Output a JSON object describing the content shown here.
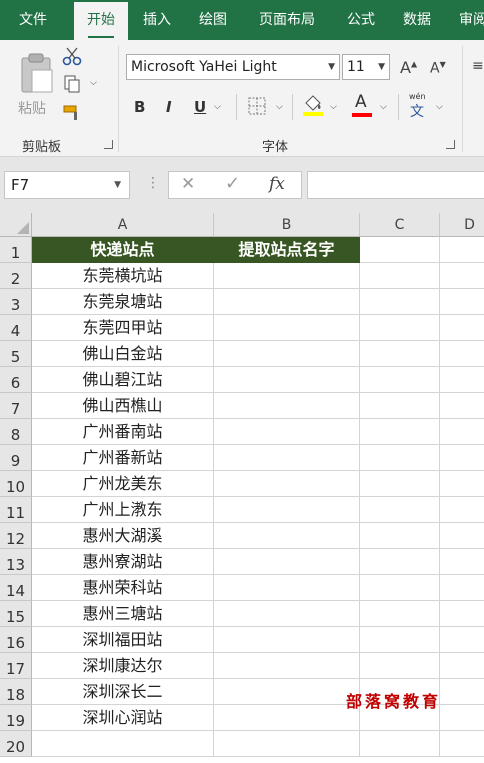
{
  "tabs": [
    {
      "label": "文件",
      "active": false
    },
    {
      "label": "开始",
      "active": true
    },
    {
      "label": "插入",
      "active": false
    },
    {
      "label": "绘图",
      "active": false
    },
    {
      "label": "页面布局",
      "active": false
    },
    {
      "label": "公式",
      "active": false
    },
    {
      "label": "数据",
      "active": false
    },
    {
      "label": "审阅",
      "active": false
    }
  ],
  "ribbon": {
    "clipboard": {
      "paste_label": "粘贴",
      "group_label": "剪贴板"
    },
    "font": {
      "font_name": "Microsoft YaHei Light",
      "font_size": "11",
      "bold_label": "B",
      "italic_label": "I",
      "underline_label": "U",
      "grow_label": "A",
      "shrink_label": "A",
      "font_color_label": "A",
      "phonetic_label": "wén",
      "phonetic_char": "文",
      "group_label": "字体",
      "highlight_color": "#ffff00",
      "font_color": "#ff0000"
    }
  },
  "formula_bar": {
    "name_box": "F7",
    "cancel_symbol": "✕",
    "enter_symbol": "✓",
    "fx_label": "fx",
    "formula": ""
  },
  "sheet": {
    "columns": [
      "A",
      "B",
      "C",
      "D"
    ],
    "rows": [
      {
        "num": "1",
        "a": "快递站点",
        "b": "提取站点名字"
      },
      {
        "num": "2",
        "a": "东莞横坑站",
        "b": ""
      },
      {
        "num": "3",
        "a": "东莞泉塘站",
        "b": ""
      },
      {
        "num": "4",
        "a": "东莞四甲站",
        "b": ""
      },
      {
        "num": "5",
        "a": "佛山白金站",
        "b": ""
      },
      {
        "num": "6",
        "a": "佛山碧江站",
        "b": ""
      },
      {
        "num": "7",
        "a": "佛山西樵山",
        "b": ""
      },
      {
        "num": "8",
        "a": "广州番南站",
        "b": ""
      },
      {
        "num": "9",
        "a": "广州番新站",
        "b": ""
      },
      {
        "num": "10",
        "a": "广州龙美东",
        "b": ""
      },
      {
        "num": "11",
        "a": "广州上漖东",
        "b": ""
      },
      {
        "num": "12",
        "a": "惠州大湖溪",
        "b": ""
      },
      {
        "num": "13",
        "a": "惠州寮湖站",
        "b": ""
      },
      {
        "num": "14",
        "a": "惠州荣科站",
        "b": ""
      },
      {
        "num": "15",
        "a": "惠州三塘站",
        "b": ""
      },
      {
        "num": "16",
        "a": "深圳福田站",
        "b": ""
      },
      {
        "num": "17",
        "a": "深圳康达尔",
        "b": ""
      },
      {
        "num": "18",
        "a": "深圳深长二",
        "b": ""
      },
      {
        "num": "19",
        "a": "深圳心润站",
        "b": ""
      },
      {
        "num": "20",
        "a": "",
        "b": ""
      }
    ],
    "header_fill": "#375623"
  },
  "watermark": "部落窝教育"
}
